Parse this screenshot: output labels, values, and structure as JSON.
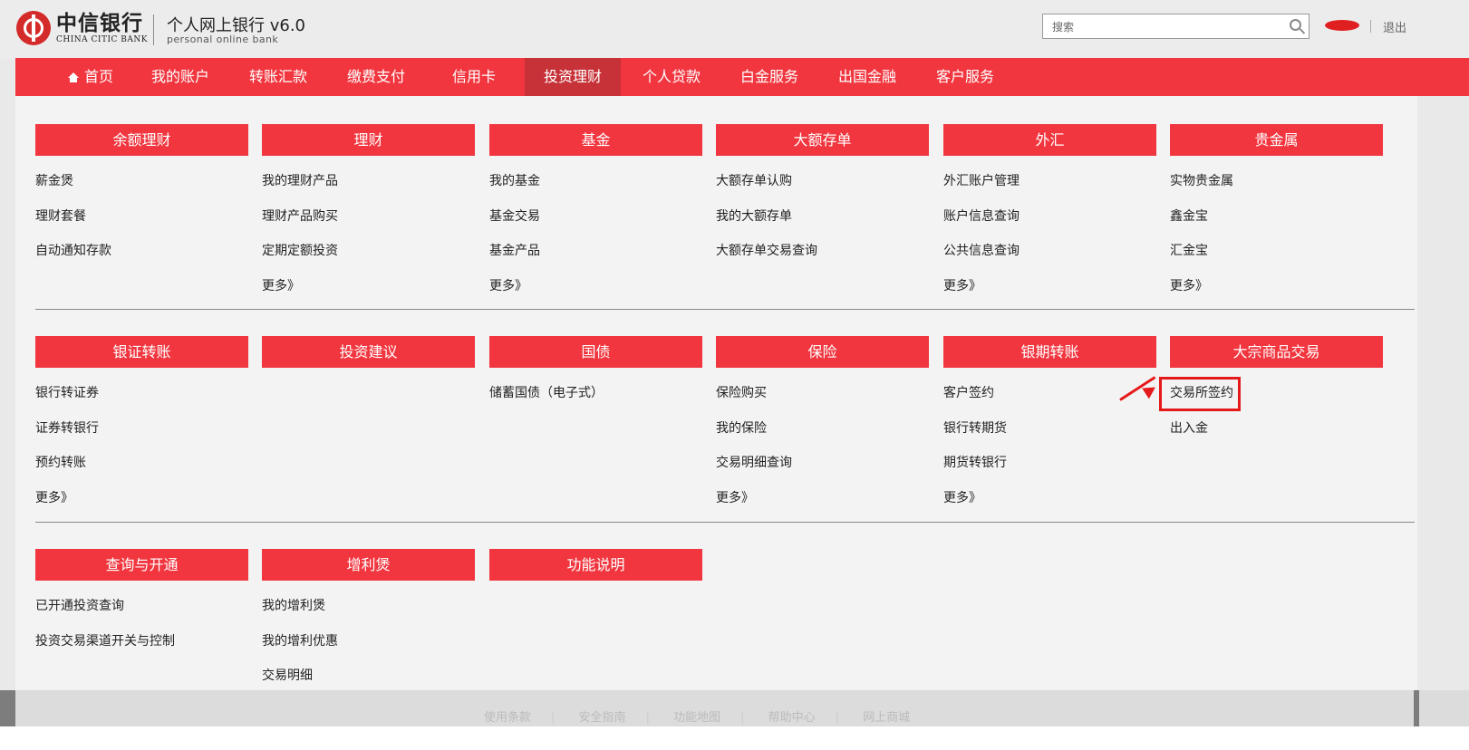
{
  "header": {
    "logo_cn": "中信银行",
    "logo_en": "CHINA CITIC BANK",
    "app_title": "个人网上银行 v6.0",
    "app_subtitle": "personal online bank",
    "search_placeholder": "搜索",
    "logout": "退出"
  },
  "nav": {
    "items": [
      {
        "label": "首页"
      },
      {
        "label": "我的账户"
      },
      {
        "label": "转账汇款"
      },
      {
        "label": "缴费支付"
      },
      {
        "label": "信用卡"
      },
      {
        "label": "投资理财"
      },
      {
        "label": "个人贷款"
      },
      {
        "label": "白金服务"
      },
      {
        "label": "出国金融"
      },
      {
        "label": "客户服务"
      }
    ],
    "active": "投资理财"
  },
  "menu": {
    "row1": [
      {
        "title": "余额理财",
        "links": [
          "薪金煲",
          "理财套餐",
          "自动通知存款"
        ]
      },
      {
        "title": "理财",
        "links": [
          "我的理财产品",
          "理财产品购买",
          "定期定额投资",
          "更多》"
        ]
      },
      {
        "title": "基金",
        "links": [
          "我的基金",
          "基金交易",
          "基金产品",
          "更多》"
        ]
      },
      {
        "title": "大额存单",
        "links": [
          "大额存单认购",
          "我的大额存单",
          "大额存单交易查询"
        ]
      },
      {
        "title": "外汇",
        "links": [
          "外汇账户管理",
          "账户信息查询",
          "公共信息查询",
          "更多》"
        ]
      },
      {
        "title": "贵金属",
        "links": [
          "实物贵金属",
          "鑫金宝",
          "汇金宝",
          "更多》"
        ]
      }
    ],
    "row2": [
      {
        "title": "银证转账",
        "links": [
          "银行转证券",
          "证券转银行",
          "预约转账",
          "更多》"
        ]
      },
      {
        "title": "投资建议",
        "links": []
      },
      {
        "title": "国债",
        "links": [
          "储蓄国债（电子式）"
        ]
      },
      {
        "title": "保险",
        "links": [
          "保险购买",
          "我的保险",
          "交易明细查询",
          "更多》"
        ]
      },
      {
        "title": "银期转账",
        "links": [
          "客户签约",
          "银行转期货",
          "期货转银行",
          "更多》"
        ]
      },
      {
        "title": "大宗商品交易",
        "links": [
          "交易所签约",
          "出入金"
        ]
      }
    ],
    "row3": [
      {
        "title": "查询与开通",
        "links": [
          "已开通投资查询",
          "投资交易渠道开关与控制"
        ]
      },
      {
        "title": "增利煲",
        "links": [
          "我的增利煲",
          "我的增利优惠",
          "交易明细"
        ]
      },
      {
        "title": "功能说明",
        "links": []
      }
    ]
  },
  "footer": {
    "links": [
      "使用条款",
      "安全指南",
      "功能地图",
      "帮助中心",
      "网上商城"
    ]
  },
  "colors": {
    "brand_red": "#f1363f",
    "nav_active": "#c63238",
    "annotation_red": "#e51919"
  }
}
